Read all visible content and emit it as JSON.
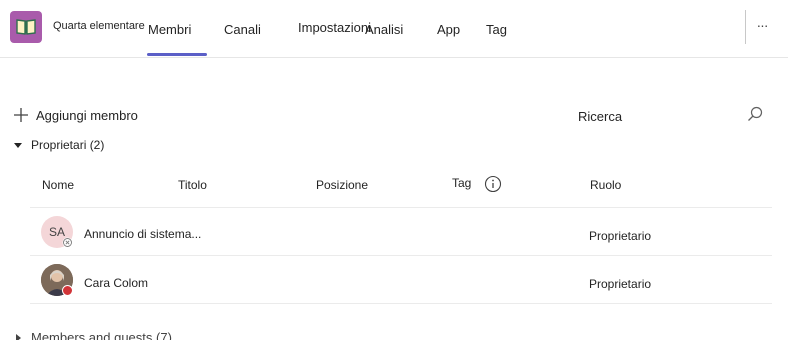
{
  "team": {
    "name": "Quarta elementare"
  },
  "tabs": [
    {
      "label": "Membri",
      "active": true
    },
    {
      "label": "Canali"
    },
    {
      "label": "Impostazioni"
    },
    {
      "label": "Analisi"
    },
    {
      "label": "App"
    },
    {
      "label": "Tag"
    }
  ],
  "toolbar": {
    "more_label": "···",
    "add_member_label": "Aggiungi membro",
    "search_label": "Ricerca"
  },
  "owners_section": {
    "label": "Proprietari (2)",
    "expanded": true
  },
  "columns": {
    "name": "Nome",
    "title": "Titolo",
    "location": "Posizione",
    "tag": "Tag",
    "role": "Ruolo"
  },
  "members": [
    {
      "initials": "SA",
      "name": "Annuncio di sistema...",
      "title": "",
      "location": "",
      "tags": "",
      "role": "Proprietario",
      "status": "offline"
    },
    {
      "initials": "",
      "name": "Cara Colom",
      "title": "",
      "location": "",
      "tags": "",
      "role": "Proprietario",
      "status": "busy"
    }
  ],
  "members_section": {
    "label": "Members and guests (7)",
    "expanded": false
  },
  "colors": {
    "accent": "#5b5fc7",
    "team_tile": "#a95bab",
    "busy": "#d13438",
    "avatar_bg": "#f4d6d8"
  }
}
